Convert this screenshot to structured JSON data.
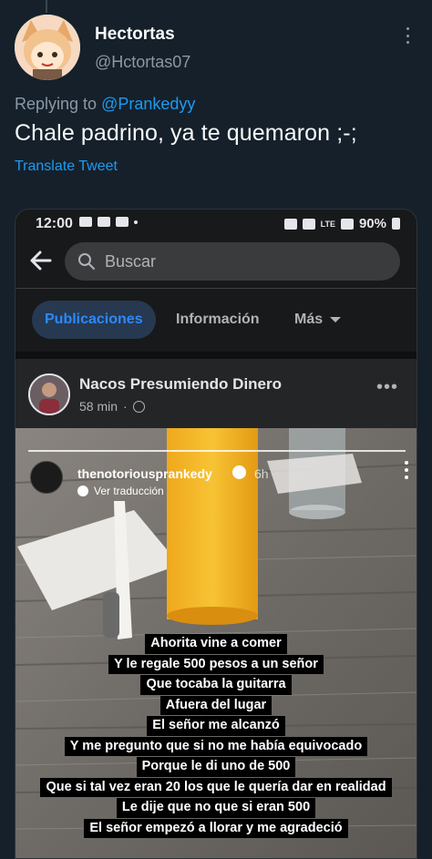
{
  "tweet": {
    "display_name": "Hectortas",
    "handle": "@Hctortas07",
    "replying_prefix": "Replying to",
    "replying_to": "@Prankedyy",
    "text": "Chale padrino, ya te quemaron ;-;",
    "translate_label": "Translate Tweet"
  },
  "screenshot": {
    "status_bar": {
      "time": "12:00",
      "battery": "90%",
      "network_label": "LTE"
    },
    "search": {
      "placeholder": "Buscar"
    },
    "tabs": [
      {
        "label": "Publicaciones",
        "active": true
      },
      {
        "label": "Información",
        "active": false
      },
      {
        "label": "Más",
        "active": false
      }
    ],
    "post": {
      "page_name": "Nacos Presumiendo Dinero",
      "time": "58 min"
    },
    "story": {
      "username": "thenotoriousprankedy",
      "time": "6h",
      "translate_label": "Ver traducción",
      "captions": [
        "Ahorita vine a comer",
        "Y le regale 500 pesos a un señor",
        "Que tocaba la guitarra",
        "Afuera del lugar",
        "El señor me alcanzó",
        "Y me pregunto que si no me había equivocado",
        "Porque le di uno de 500",
        "Que si tal vez eran 20 los que le quería dar en realidad",
        "Le dije que no que si eran 500",
        "El señor empezó a llorar y me agradeció"
      ]
    }
  },
  "colors": {
    "background": "#15202b",
    "link": "#1d9bf0",
    "fb_active_tab": "#2d88ff",
    "fb_surface": "#242526"
  }
}
